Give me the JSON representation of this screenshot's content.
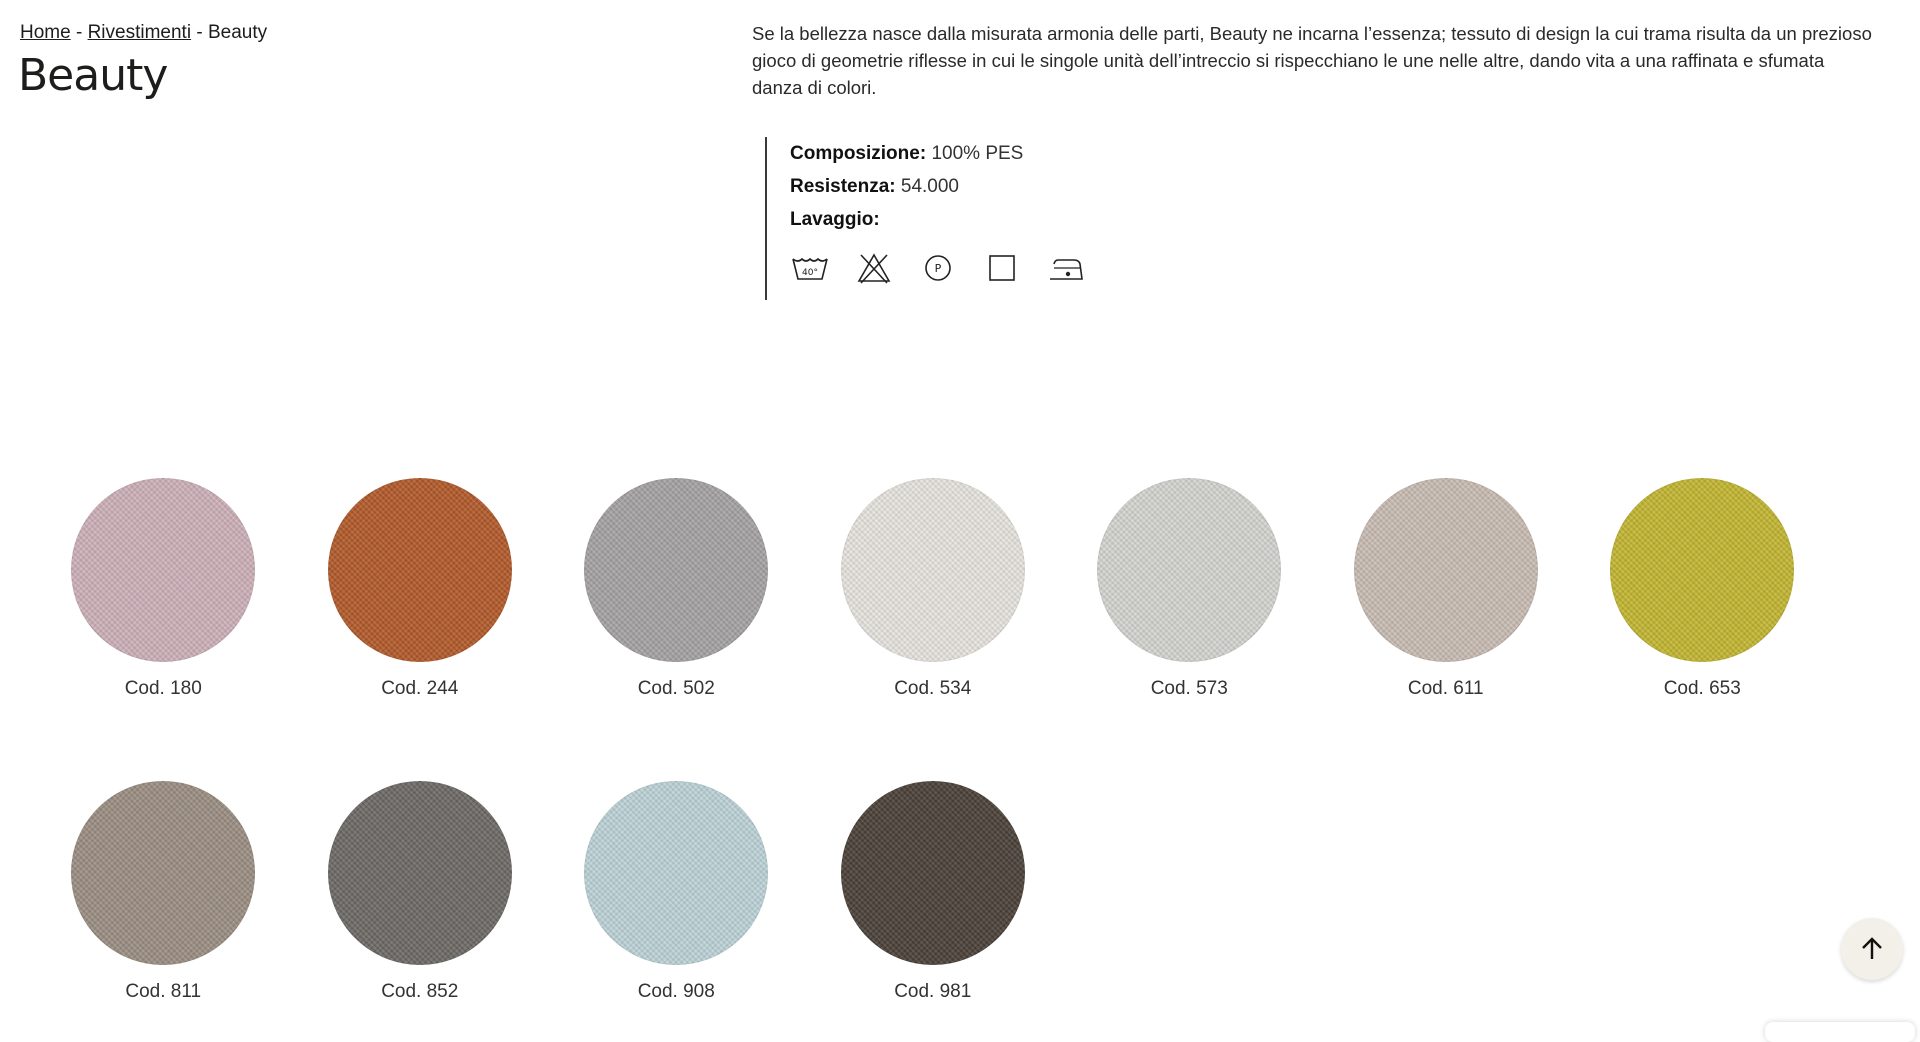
{
  "breadcrumb": {
    "home": "Home",
    "sep1": " - ",
    "category": "Rivestimenti",
    "sep2": " - ",
    "current": "Beauty"
  },
  "title": "Beauty",
  "description": "Se la bellezza nasce dalla misurata armonia delle parti, Beauty ne incarna l’essenza; tessuto di design la cui trama risulta da un prezioso gioco di geometrie riflesse in cui le singole unità dell’intreccio si rispecchiano le une nelle altre, dando vita a una raffinata e sfumata danza di colori.",
  "specs": {
    "composition_label": "Composizione:",
    "composition_value": " 100% PES",
    "resistance_label": "Resistenza:",
    "resistance_value": " 54.000",
    "washing_label": "Lavaggio:",
    "washing_icons": [
      "wash-40-icon",
      "no-bleach-icon",
      "dry-clean-p-icon",
      "tumble-dry-square-icon",
      "iron-icon"
    ],
    "washing_text": {
      "temp": "40°",
      "dryclean": "P"
    }
  },
  "swatches": [
    {
      "label": "Cod. 180",
      "color": "#cdb1b9"
    },
    {
      "label": "Cod. 244",
      "color": "#b35a2a"
    },
    {
      "label": "Cod. 502",
      "color": "#a5a3a3"
    },
    {
      "label": "Cod. 534",
      "color": "#e7e4de"
    },
    {
      "label": "Cod. 573",
      "color": "#d4d4d0"
    },
    {
      "label": "Cod. 611",
      "color": "#c9bdb4"
    },
    {
      "label": "Cod. 653",
      "color": "#c3b632"
    },
    {
      "label": "Cod. 811",
      "color": "#9c8f83"
    },
    {
      "label": "Cod. 852",
      "color": "#6d6a66"
    },
    {
      "label": "Cod. 908",
      "color": "#bdd3d8"
    },
    {
      "label": "Cod. 981",
      "color": "#4b4239"
    }
  ],
  "scroll_top_icon": "arrow-up-icon"
}
